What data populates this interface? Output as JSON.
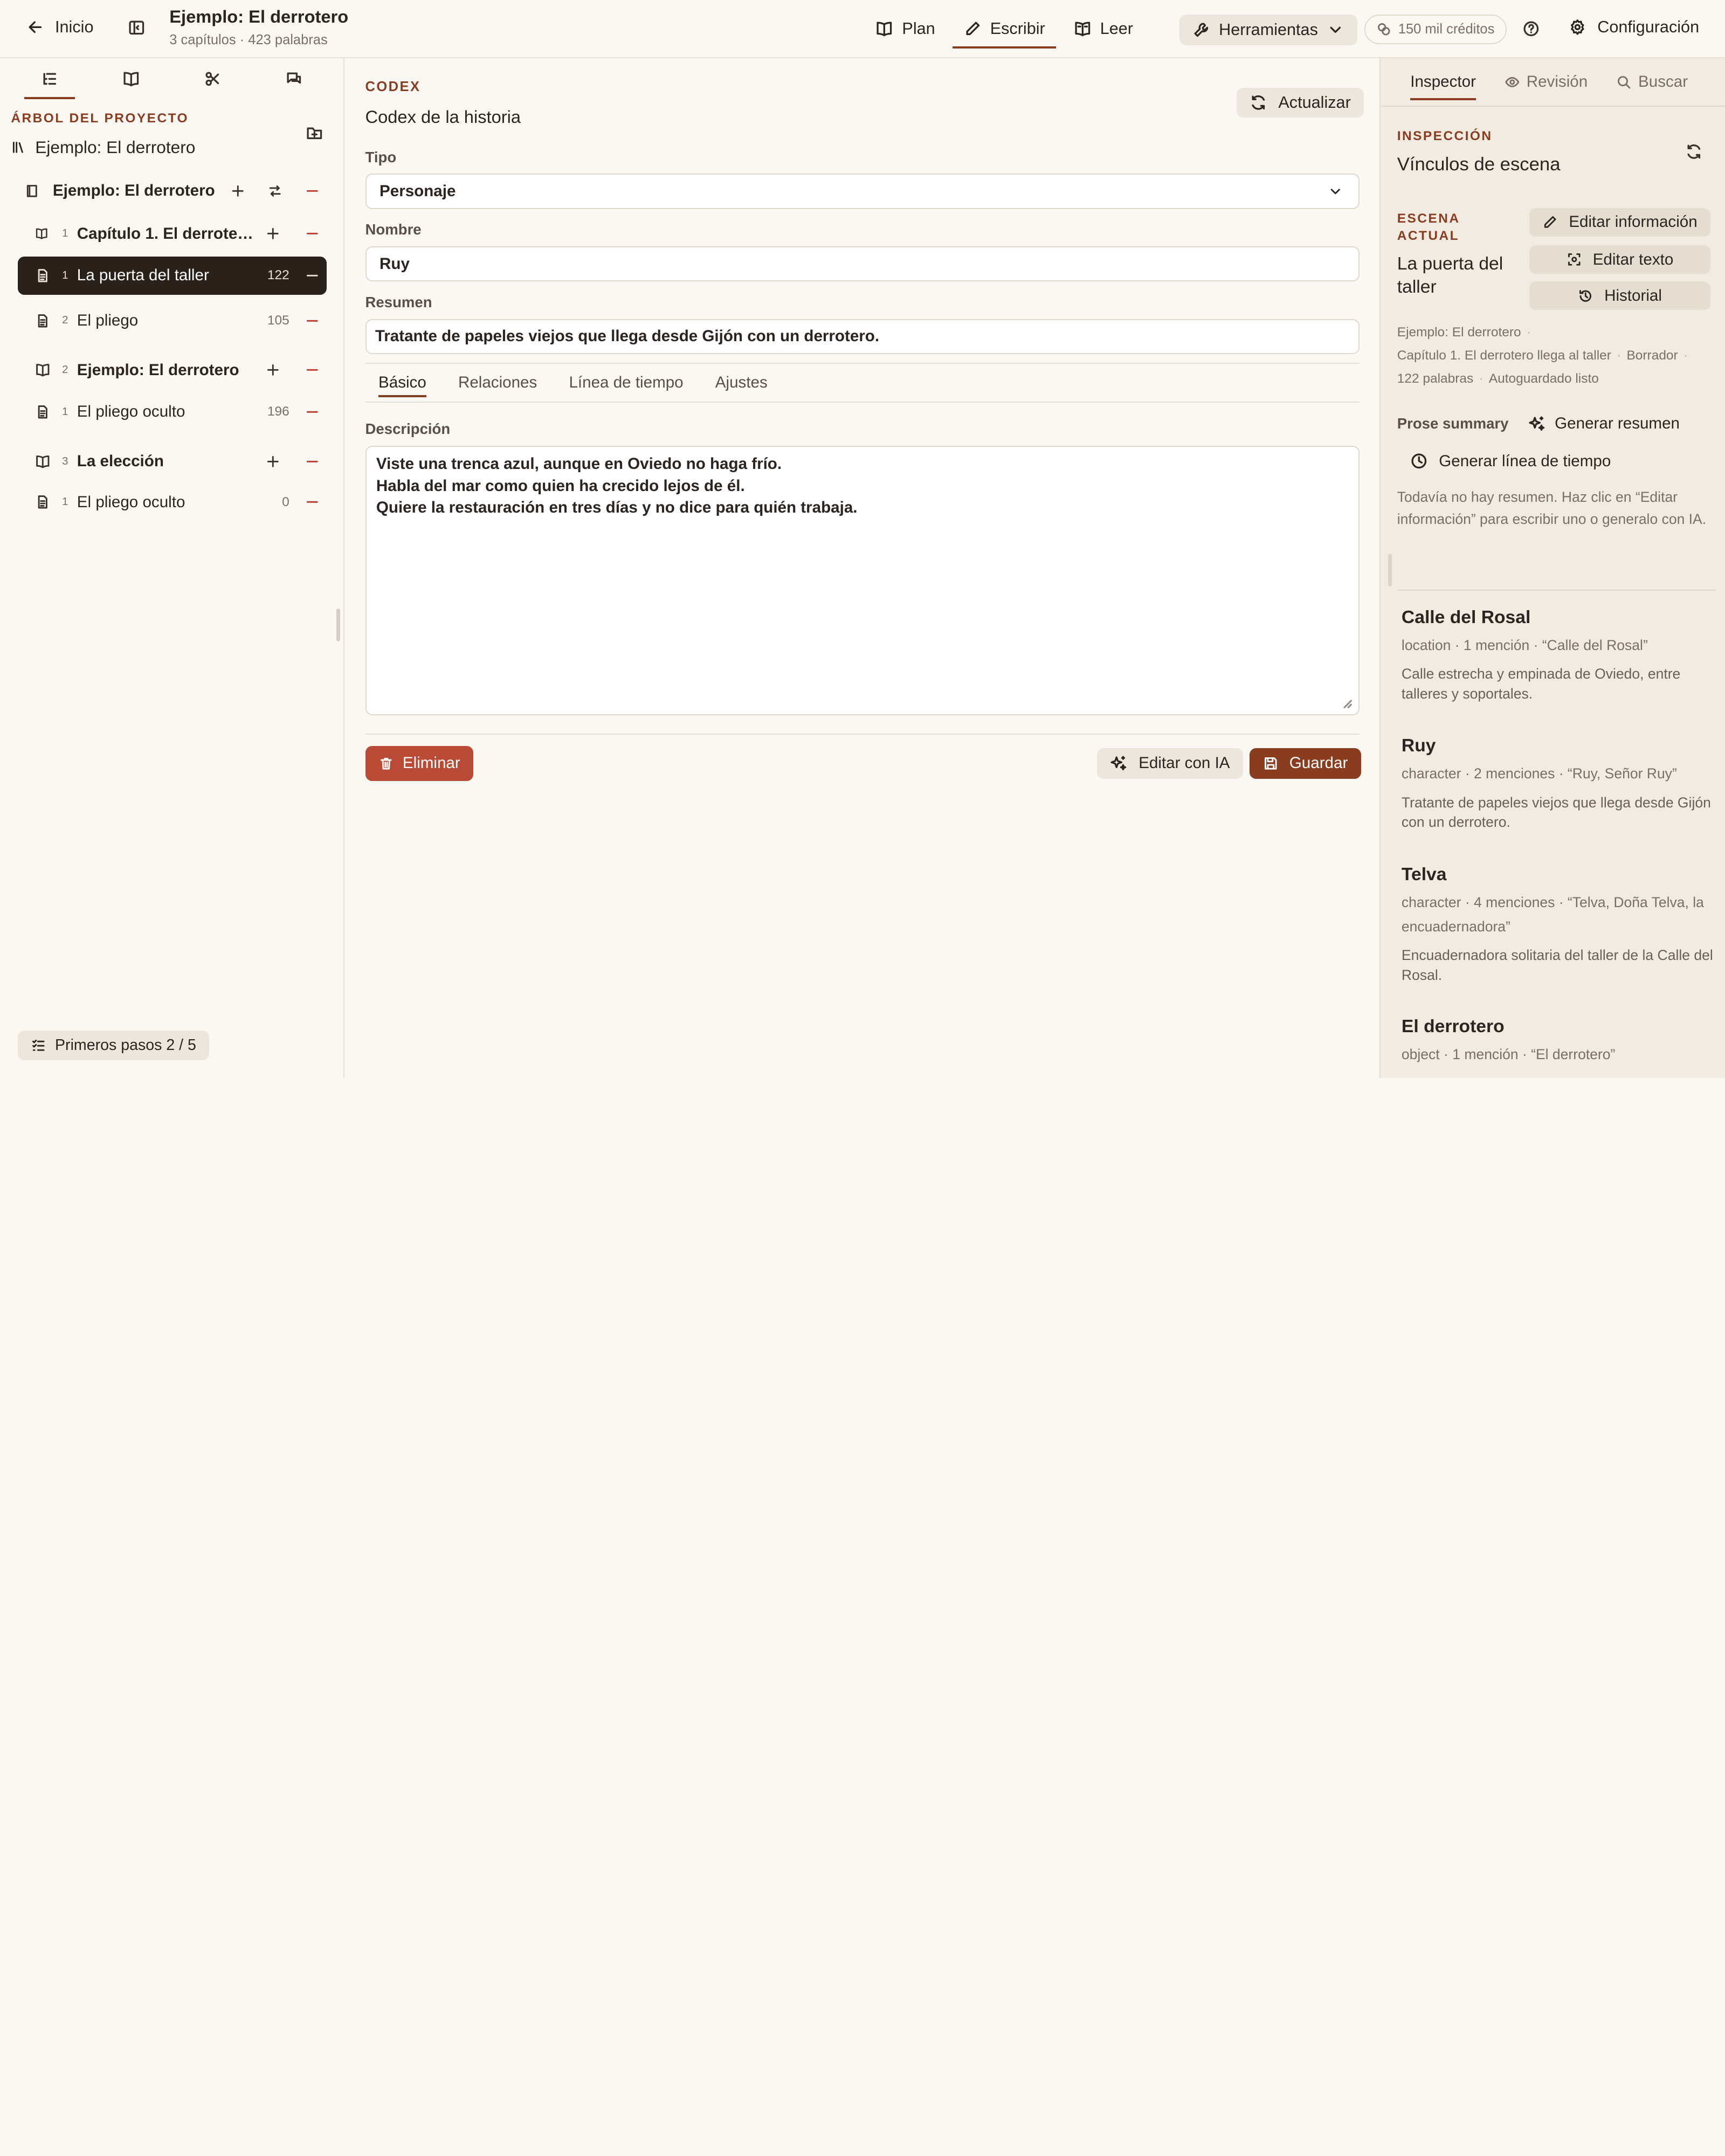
{
  "colors": {
    "accent": "#8a3d1e",
    "danger": "#b84a36",
    "selected_bg": "#2b211b",
    "background": "#fbf8f3",
    "panel_bg": "#f2ebe1"
  },
  "topbar": {
    "back_label": "Inicio",
    "project_title": "Ejemplo: El derrotero",
    "project_meta": "3 capítulos · 423 palabras",
    "modes": [
      {
        "label": "Plan",
        "icon": "book-open-icon",
        "active": false
      },
      {
        "label": "Escribir",
        "icon": "pen-icon",
        "active": true
      },
      {
        "label": "Leer",
        "icon": "book-reader-icon",
        "active": false
      }
    ],
    "tools_label": "Herramientas",
    "credits": "150 mil créditos",
    "config_label": "Configuración"
  },
  "sidebar": {
    "tabs": [
      "outline-icon",
      "book-icon",
      "scissors-icon",
      "chat-icon"
    ],
    "tree_label": "ÁRBOL DEL PROYECTO",
    "project_name": "Ejemplo: El derrotero",
    "tree": [
      {
        "type": "book",
        "num": "",
        "label": "Ejemplo: El derrotero",
        "count": ""
      },
      {
        "type": "chapter",
        "num": "1",
        "label": "Capítulo 1. El derrotero llega al taller",
        "count": ""
      },
      {
        "type": "scene",
        "num": "1",
        "label": "La puerta del taller",
        "count": "122",
        "selected": true
      },
      {
        "type": "scene",
        "num": "2",
        "label": "El pliego",
        "count": "105"
      },
      {
        "type": "chapter",
        "num": "2",
        "label": "Ejemplo: El derrotero",
        "count": ""
      },
      {
        "type": "scene",
        "num": "1",
        "label": "El pliego oculto",
        "count": "196"
      },
      {
        "type": "chapter",
        "num": "3",
        "label": "La elección",
        "count": ""
      },
      {
        "type": "scene",
        "num": "1",
        "label": "El pliego oculto",
        "count": "0"
      }
    ],
    "steps_label": "Primeros pasos 2 / 5"
  },
  "editor": {
    "section_label": "CODEX",
    "title": "Codex de la historia",
    "refresh_label": "Actualizar",
    "type_label": "Tipo",
    "type_value": "Personaje",
    "name_label": "Nombre",
    "name_value": "Ruy",
    "summary_label": "Resumen",
    "summary_value": "Tratante de papeles viejos que llega desde Gijón con un derrotero.",
    "tabs": [
      "Básico",
      "Relaciones",
      "Línea de tiempo",
      "Ajustes"
    ],
    "description_label": "Descripción",
    "description_lines": [
      "Viste una trenca azul, aunque en Oviedo no haga frío.",
      "Habla del mar como quien ha crecido lejos de él.",
      "Quiere la restauración en tres días y no dice para quién trabaja."
    ],
    "delete_label": "Eliminar",
    "ai_label": "Editar con IA",
    "save_label": "Guardar"
  },
  "inspector": {
    "tabs": [
      "Inspector",
      "Revisión",
      "Buscar"
    ],
    "section_label": "INSPECCIÓN",
    "title": "Vínculos de escena",
    "scene_label_1": "ESCENA",
    "scene_label_2": "ACTUAL",
    "scene_name": "La puerta del taller",
    "edit_info": "Editar información",
    "edit_text": "Editar texto",
    "history": "Historial",
    "meta": [
      "Ejemplo: El derrotero",
      "Capítulo 1. El derrotero llega al taller",
      "Borrador",
      "122 palabras",
      "Autoguardado listo"
    ],
    "prose_summary": "Prose summary",
    "generate_summary": "Generar resumen",
    "generate_timeline": "Generar línea de tiempo",
    "empty_summary": "Todavía no hay resumen. Haz clic en “Editar información” para escribir uno o generalo con IA.",
    "entities": [
      {
        "name": "Calle del Rosal",
        "meta": "location · 1 mención · “Calle del Rosal”",
        "desc": "Calle estrecha y empinada de Oviedo, entre talleres y soportales."
      },
      {
        "name": "Ruy",
        "meta": "character · 2 menciones · “Ruy, Señor Ruy”",
        "desc": "Tratante de papeles viejos que llega desde Gijón con un derrotero."
      },
      {
        "name": "Telva",
        "meta": "character · 4 menciones · “Telva, Doña Telva, la encuadernadora”",
        "desc": "Encuadernadora solitaria del taller de la Calle del Rosal."
      },
      {
        "name": "El derrotero",
        "meta": "object · 1 mención · “El derrotero”",
        "desc": ""
      }
    ]
  }
}
